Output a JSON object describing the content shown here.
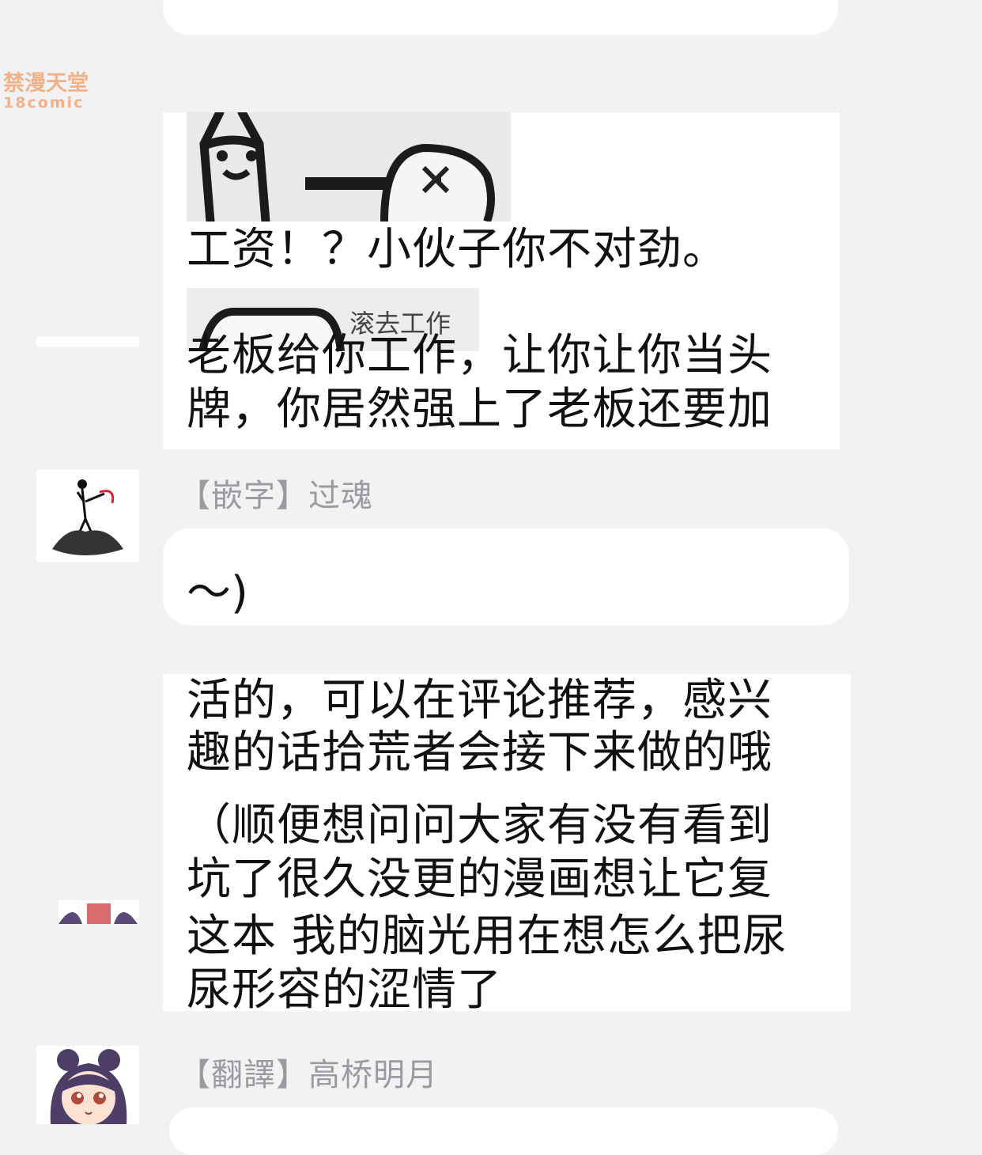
{
  "watermark": {
    "line1": "禁漫天堂",
    "line2": "18comic"
  },
  "messages": [
    {
      "sticker_caption": "滚去工作",
      "text_top": "工资！？小伙子你不对劲。",
      "text_main": "老板给你工作，让你让你当头牌，你居然强上了老板还要加"
    },
    {
      "sender": "【嵌字】过魂",
      "text_fragment": "～)"
    },
    {
      "text_lines": [
        "活的，可以在评论推荐，感兴",
        "趣的话拾荒者会接下来做的哦",
        "（顺便想问问大家有没有看到",
        "坑了很久没更的漫画想让它复",
        "这本 我的脑光用在想怎么把尿",
        "尿形容的涩情了"
      ]
    },
    {
      "sender": "【翻譯】高桥明月"
    }
  ]
}
